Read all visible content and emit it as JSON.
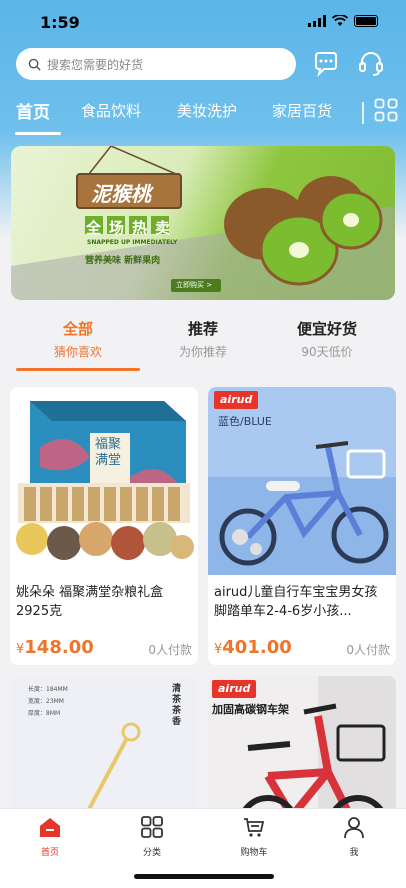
{
  "status": {
    "time": "1:59"
  },
  "search": {
    "placeholder": "搜索您需要的好货"
  },
  "tabs": [
    "首页",
    "食品饮料",
    "美妆洗护",
    "家居百货"
  ],
  "banner": {
    "title": "泥猴桃",
    "headline": "全场热卖",
    "subline": "SNAPPED UP IMMEDIATELY",
    "slogan": "营养美味 新鲜果肉",
    "cta": "立即购买 >"
  },
  "filters": [
    {
      "title": "全部",
      "sub": "猜你喜欢"
    },
    {
      "title": "推荐",
      "sub": "为你推荐"
    },
    {
      "title": "便宜好货",
      "sub": "90天低价"
    }
  ],
  "products": [
    {
      "name": "姚朵朵 福聚满堂杂粮礼盒2925克",
      "currency": "¥",
      "price": "148.00",
      "paid": "0人付款",
      "box_text": "福聚满堂"
    },
    {
      "name": "airud儿童自行车宝宝男女孩脚踏单车2-4-6岁小孩...",
      "currency": "¥",
      "price": "401.00",
      "paid": "0人付款",
      "brand": "airud",
      "tag": "蓝色/BLUE"
    },
    {
      "name": "",
      "spec_lines": [
        "长度：184MM",
        "宽度：23MM",
        "厚度：8MM"
      ],
      "side_text": "清茶茶香"
    },
    {
      "name": "",
      "brand": "airud",
      "tag": "加固高碳钢车架"
    }
  ],
  "tabbar": [
    {
      "label": "首页",
      "icon": "home-icon"
    },
    {
      "label": "分类",
      "icon": "grid-icon"
    },
    {
      "label": "购物车",
      "icon": "cart-icon"
    },
    {
      "label": "我",
      "icon": "user-icon"
    }
  ]
}
